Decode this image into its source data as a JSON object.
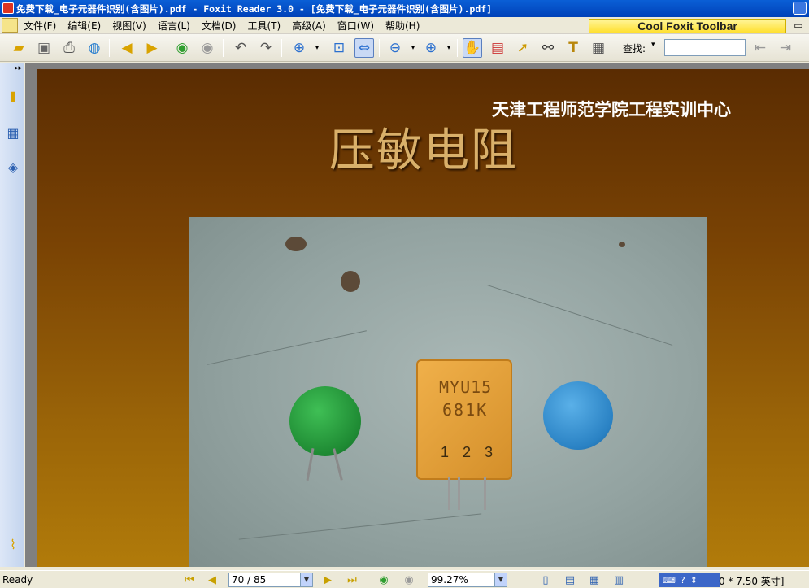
{
  "window": {
    "title": "免费下载_电子元器件识别(含图片).pdf - Foxit Reader 3.0 - [免费下载_电子元器件识别(含图片).pdf]"
  },
  "menu": {
    "items": [
      "文件(F)",
      "编辑(E)",
      "视图(V)",
      "语言(L)",
      "文档(D)",
      "工具(T)",
      "高级(A)",
      "窗口(W)",
      "帮助(H)"
    ]
  },
  "cool_toolbar": {
    "label": "Cool Foxit Toolbar"
  },
  "find": {
    "label": "查找:",
    "value": ""
  },
  "pdf": {
    "header": "天津工程师范学院工程实训中心",
    "title": "压敏电阻",
    "component_marks": {
      "line1": "MYU15",
      "line2": "681K",
      "pins": "1 2  3"
    }
  },
  "status": {
    "ready": "Ready",
    "page_display": "70 / 85",
    "zoom_display": "99.27%",
    "page_size": "0 * 7.50 英寸]"
  },
  "colors": {
    "titlebar": "#0a5fd6",
    "page_top": "#5a2c02",
    "page_bottom": "#b27c0a",
    "title_text": "#d9b06a"
  }
}
